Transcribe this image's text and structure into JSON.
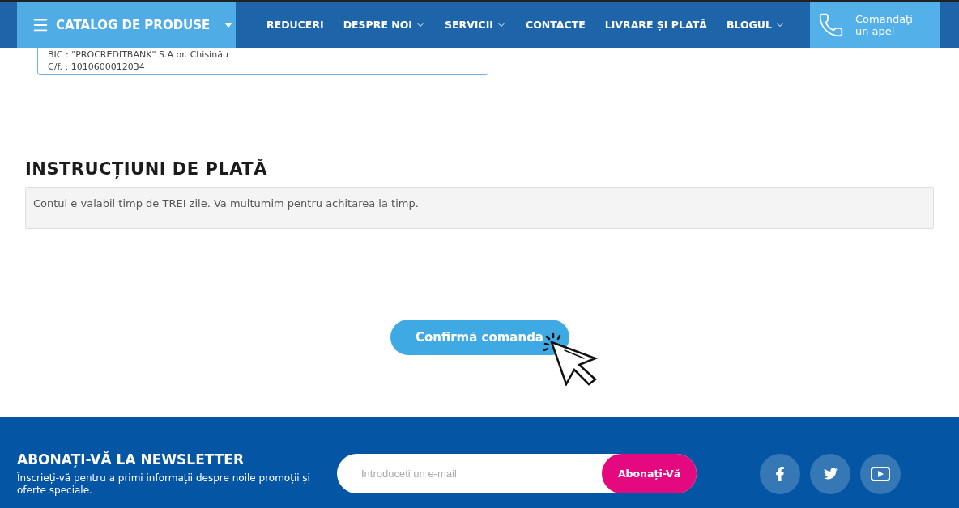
{
  "header": {
    "catalog_button": "CATALOG DE PRODUSE",
    "nav": [
      {
        "label": "REDUCERI",
        "dropdown": false
      },
      {
        "label": "DESPRE NOI",
        "dropdown": true
      },
      {
        "label": "SERVICII",
        "dropdown": true
      },
      {
        "label": "CONTACTE",
        "dropdown": false
      },
      {
        "label": "LIVRARE ȘI PLATĂ",
        "dropdown": false
      },
      {
        "label": "BLOGUL",
        "dropdown": true
      }
    ],
    "call_button": "Comandați un apel"
  },
  "bank_details": [
    "BIC : \"PROCREDITBANK\" S.A or. Chișinău",
    "C/f. : 1010600012034"
  ],
  "payment_instructions": {
    "title": "INSTRUCȚIUNI DE PLATĂ",
    "text": "Contul e valabil timp de TREI zile. Va multumim pentru achitarea la timp."
  },
  "confirm_button": "Confirmă comanda",
  "footer": {
    "newsletter_title": "ABONAȚI-VĂ LA NEWSLETTER",
    "newsletter_text": "Înscrieți-vă pentru a primi informații despre noile promoții și oferte speciale.",
    "email_placeholder": "Introduceti un e-mail",
    "subscribe_button": "Abonați-Vă",
    "social": [
      {
        "kind": "facebook"
      },
      {
        "kind": "twitter"
      },
      {
        "kind": "youtube"
      }
    ]
  }
}
